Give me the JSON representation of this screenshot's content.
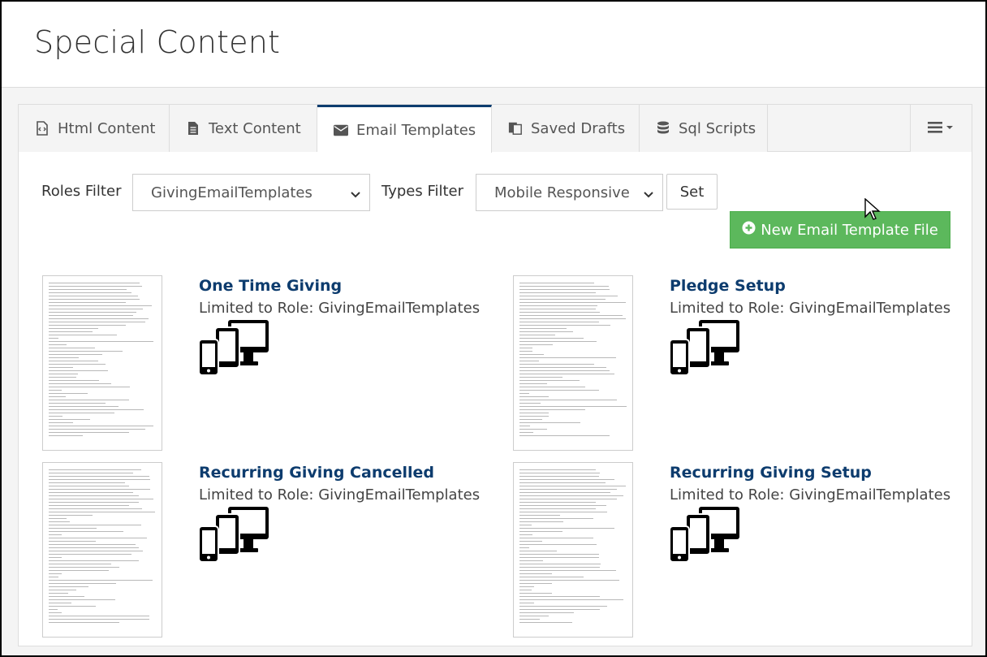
{
  "page": {
    "title": "Special Content"
  },
  "tabs": [
    {
      "label": "Html Content",
      "icon": "file-code-icon"
    },
    {
      "label": "Text Content",
      "icon": "file-text-icon"
    },
    {
      "label": "Email Templates",
      "icon": "envelope-icon",
      "active": true
    },
    {
      "label": "Saved Drafts",
      "icon": "copy-icon"
    },
    {
      "label": "Sql Scripts",
      "icon": "database-icon"
    }
  ],
  "filters": {
    "roles_label": "Roles Filter",
    "roles_value": "GivingEmailTemplates",
    "types_label": "Types Filter",
    "types_value": "Mobile Responsive",
    "set_label": "Set",
    "new_label": "New Email Template File"
  },
  "templates": [
    {
      "title": "One Time Giving",
      "subtitle": "Limited to Role: GivingEmailTemplates"
    },
    {
      "title": "Pledge Setup",
      "subtitle": "Limited to Role: GivingEmailTemplates"
    },
    {
      "title": "Recurring Giving Cancelled",
      "subtitle": "Limited to Role: GivingEmailTemplates"
    },
    {
      "title": "Recurring Giving Setup",
      "subtitle": "Limited to Role: GivingEmailTemplates"
    }
  ],
  "colors": {
    "accent": "#0d3c6e",
    "success": "#5cb85c"
  }
}
